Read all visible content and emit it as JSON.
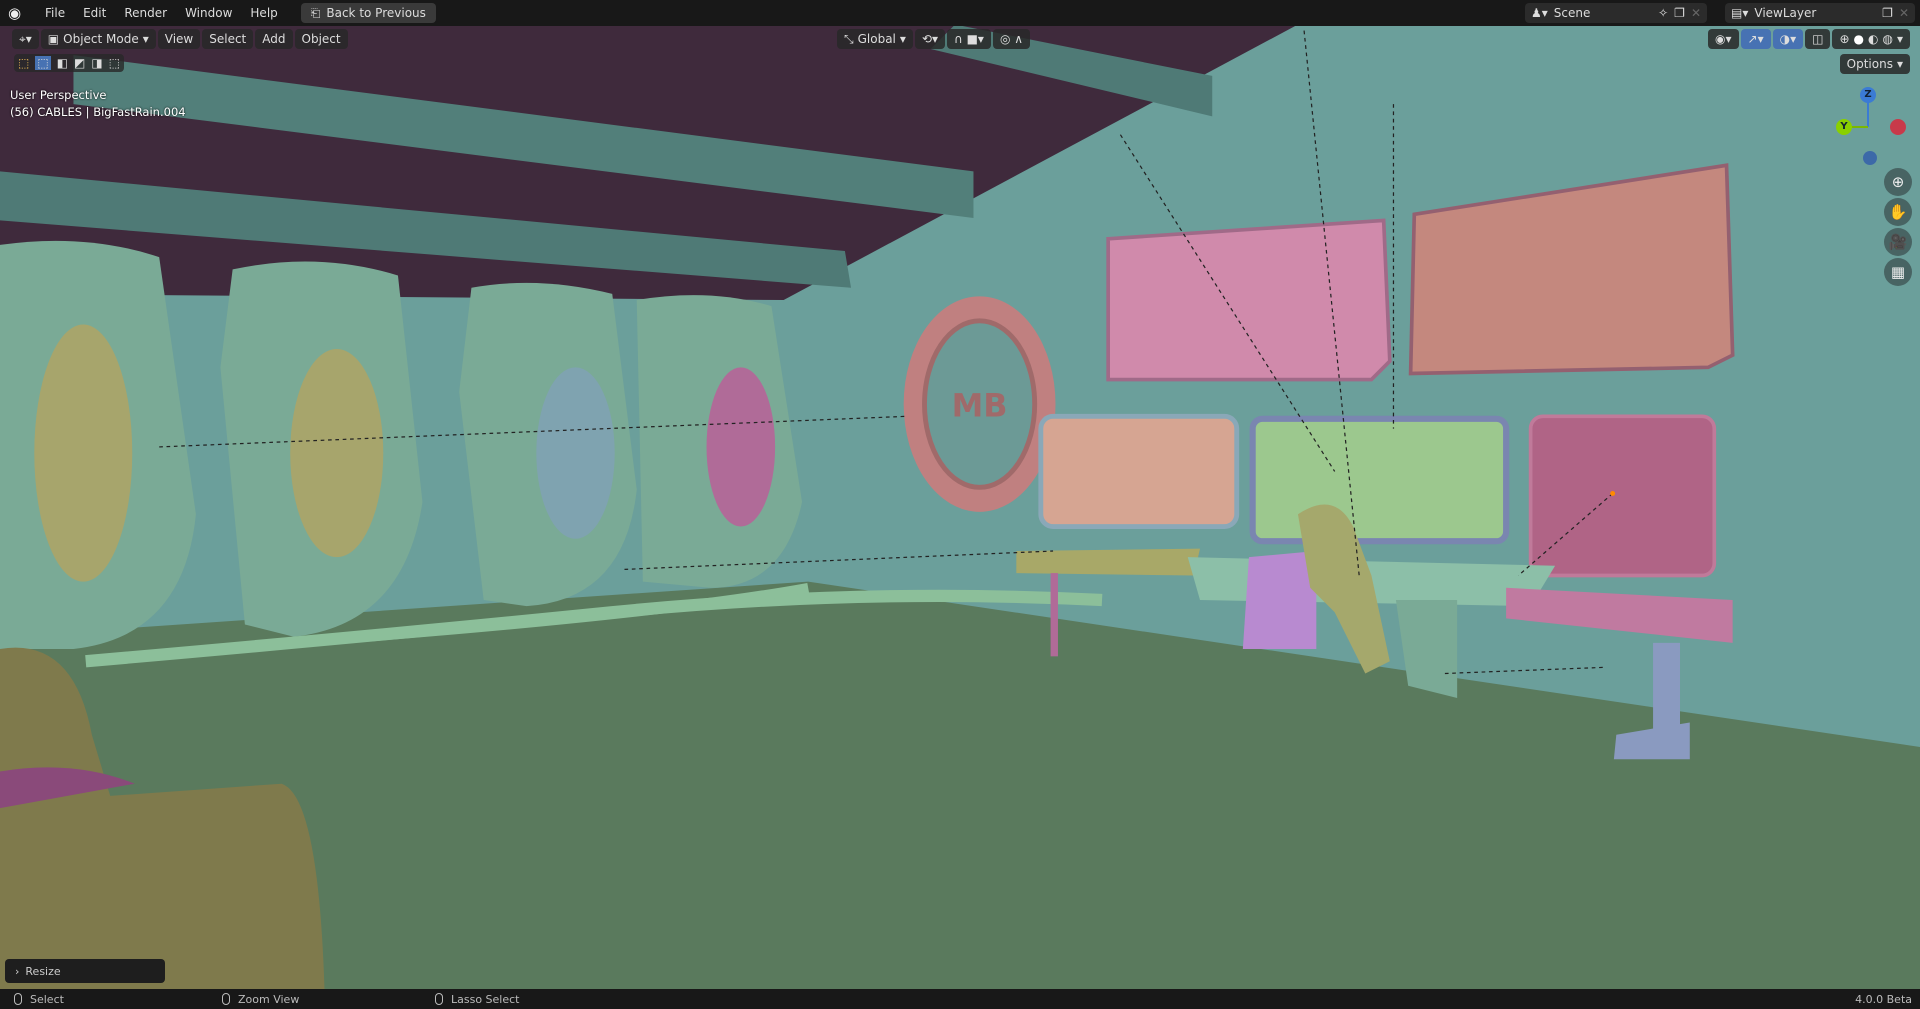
{
  "menu": {
    "items": [
      "File",
      "Edit",
      "Render",
      "Window",
      "Help"
    ],
    "back_button": "Back to Previous"
  },
  "scene_selector": {
    "value": "Scene"
  },
  "viewlayer_selector": {
    "value": "ViewLayer"
  },
  "viewport_header": {
    "mode": "Object Mode",
    "menus": [
      "View",
      "Select",
      "Add",
      "Object"
    ],
    "orientation": "Global",
    "options": "Options"
  },
  "overlay": {
    "view_name": "User Perspective",
    "object_info": "(56) CABLES | BigFastRain.004",
    "logo_text": "MB"
  },
  "gizmo": {
    "z": "Z",
    "y": "Y"
  },
  "operator_panel": {
    "label": "Resize"
  },
  "status_bar": {
    "select": "Select",
    "zoom": "Zoom View",
    "lasso": "Lasso Select",
    "version": "4.0.0 Beta"
  },
  "colors": {
    "accent": "#4772b3",
    "wall": "#6b9f9b",
    "floor": "#5a7a5d",
    "ceiling": "#3f2a3c"
  }
}
